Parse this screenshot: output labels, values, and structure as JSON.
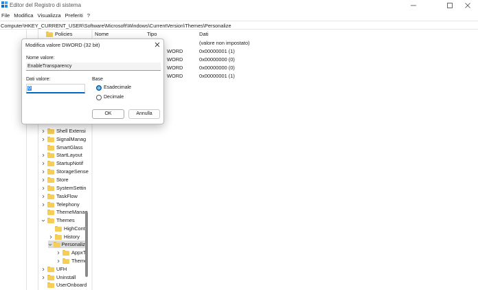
{
  "window": {
    "title": "Editor del Registro di sistema"
  },
  "menu": [
    "File",
    "Modifica",
    "Visualizza",
    "Preferiti",
    "?"
  ],
  "address": "Computer\\HKEY_CURRENT_USER\\Software\\Microsoft\\Windows\\CurrentVersion\\Themes\\Personalize",
  "tree": {
    "items": [
      {
        "label": "Policies",
        "chevron": ""
      },
      {
        "label": "Shell Extensi",
        "chevron": ">"
      },
      {
        "label": "SignalManag",
        "chevron": ">"
      },
      {
        "label": "SmartGlass",
        "chevron": ""
      },
      {
        "label": "StartLayout",
        "chevron": ">"
      },
      {
        "label": "StartupNotif",
        "chevron": ">"
      },
      {
        "label": "StorageSense",
        "chevron": ">"
      },
      {
        "label": "Store",
        "chevron": ">"
      },
      {
        "label": "SystemSettin",
        "chevron": ">"
      },
      {
        "label": "TaskFlow",
        "chevron": ">"
      },
      {
        "label": "Telephony",
        "chevron": ">"
      },
      {
        "label": "ThemeManag",
        "chevron": ""
      },
      {
        "label": "Themes",
        "chevron": "v"
      },
      {
        "label": "HighContr",
        "chevron": ""
      },
      {
        "label": "History",
        "chevron": ">"
      },
      {
        "label": "Personaliz",
        "chevron": "v"
      },
      {
        "label": "AppxT",
        "chevron": ">"
      },
      {
        "label": "Theme",
        "chevron": ">"
      },
      {
        "label": "UFH",
        "chevron": ">"
      },
      {
        "label": "Uninstall",
        "chevron": ">"
      },
      {
        "label": "UserOnboard",
        "chevron": ""
      }
    ]
  },
  "list": {
    "headers": {
      "name": "Nome",
      "type": "Tipo",
      "data": "Dati"
    },
    "rows": [
      {
        "type": "",
        "data": "(valore non impostato)"
      },
      {
        "type": "WORD",
        "data": "0x00000001 (1)"
      },
      {
        "type": "WORD",
        "data": "0x00000000 (0)"
      },
      {
        "type": "WORD",
        "data": "0x00000000 (0)"
      },
      {
        "type": "WORD",
        "data": "0x00000001 (1)"
      }
    ]
  },
  "dialog": {
    "title": "Modifica valore DWORD (32 bit)",
    "name_label": "Nome valore:",
    "name_value": "EnableTransparency",
    "data_label": "Dati valore:",
    "data_value": "0",
    "base_label": "Base",
    "radio_hex": "Esadecimale",
    "radio_dec": "Decimale",
    "ok": "OK",
    "cancel": "Annulla"
  },
  "icons": {
    "app": "registry-editor-icon",
    "folder": "folder-icon",
    "minimize": "minimize-icon",
    "maximize": "maximize-icon",
    "close": "close-icon"
  },
  "colors": {
    "accent": "#0067c0",
    "folder": "#f6cd57",
    "selection": "#dcdcdc"
  }
}
